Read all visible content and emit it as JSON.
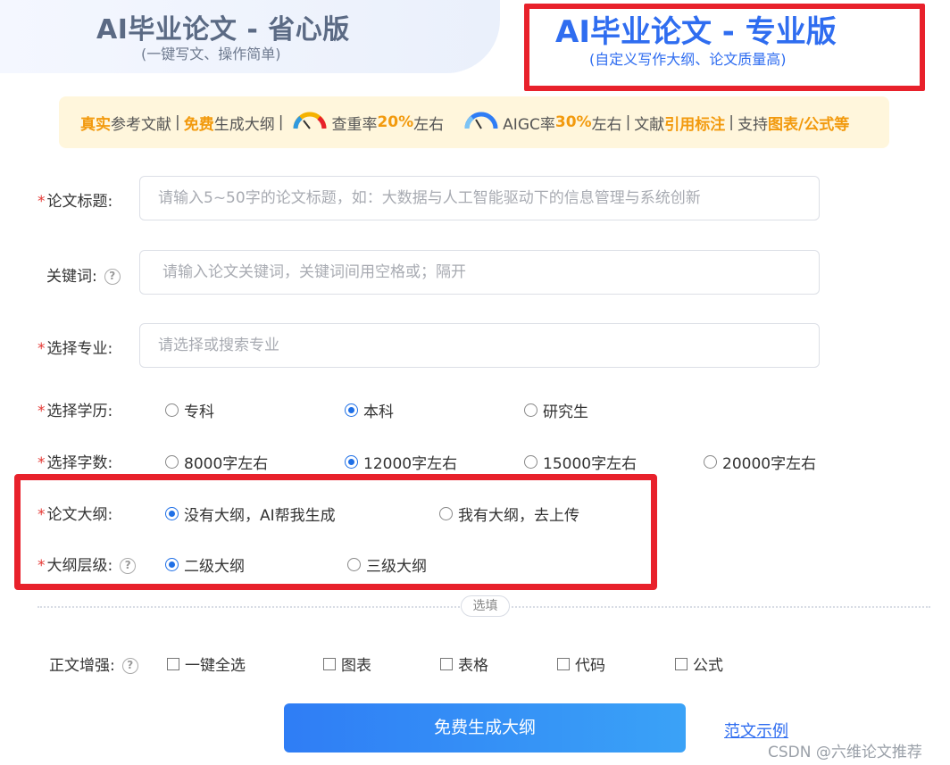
{
  "tabs": {
    "basic": {
      "title": "AI毕业论文 - 省心版",
      "subtitle": "(一键写文、操作简单)"
    },
    "pro": {
      "title": "AI毕业论文 - 专业版",
      "subtitle": "(自定义写作大纲、论文质量高)"
    }
  },
  "banner": {
    "p1a": "真实",
    "p1b": "参考文献",
    "sep1": "|",
    "p2a": "免费",
    "p2b": "生成大纲",
    "sep2": "|",
    "p3a": "查重率",
    "p3b": "20%",
    "p3c": "左右",
    "p4a": "AIGC率",
    "p4b": "30%",
    "p4c": " 左右",
    "sep3": "|",
    "p5a": "文献",
    "p5b": "引用标注",
    "sep4": "|",
    "p6a": "支持",
    "p6b": "图表/公式等",
    "gauge_colors": {
      "low": "#2f9ae0",
      "mid": "#f5b200",
      "high": "#e8212b"
    }
  },
  "form": {
    "title_field": {
      "label": "论文标题:",
      "placeholder": "请输入5~50字的论文标题，如：大数据与人工智能驱动下的信息管理与系统创新"
    },
    "keywords_field": {
      "label": "关键词:",
      "placeholder": "请输入论文关键词，关键词间用空格或；隔开"
    },
    "major_field": {
      "label": "选择专业:",
      "placeholder": "请选择或搜索专业"
    },
    "degree": {
      "label": "选择学历:",
      "options": [
        "专科",
        "本科",
        "研究生"
      ],
      "selected": "本科"
    },
    "wordcount": {
      "label": "选择字数:",
      "options": [
        "8000字左右",
        "12000字左右",
        "15000字左右",
        "20000字左右"
      ],
      "selected": "12000字左右"
    },
    "outline": {
      "label": "论文大纲:",
      "options": [
        "没有大纲，AI帮我生成",
        "我有大纲，去上传"
      ],
      "selected": "没有大纲，AI帮我生成"
    },
    "outline_level": {
      "label": "大纲层级:",
      "options": [
        "二级大纲",
        "三级大纲"
      ],
      "selected": "二级大纲"
    },
    "optional_divider": "选填",
    "enhance": {
      "label": "正文增强:",
      "options": [
        "一键全选",
        "图表",
        "表格",
        "代码",
        "公式"
      ]
    },
    "submit_label": "免费生成大纲",
    "sample_link": "范文示例"
  },
  "watermark": "CSDN @六维论文推荐",
  "colors": {
    "accent": "#2f6df0",
    "required": "#e53935",
    "highlight": "#e8212b",
    "banner_bg": "#fff6dc",
    "banner_orange": "#f29a0e"
  }
}
